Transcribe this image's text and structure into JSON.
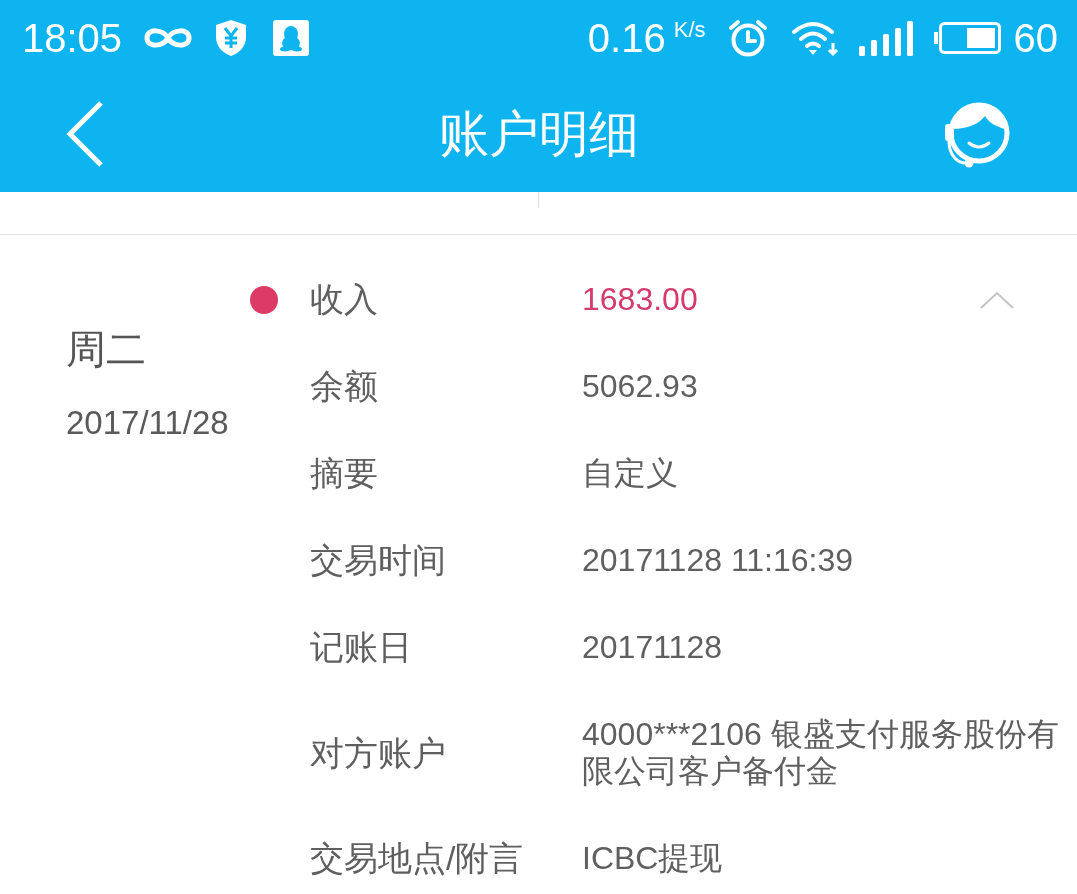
{
  "status_bar": {
    "time": "18:05",
    "net_speed": "0.16",
    "net_speed_unit": "K/s",
    "battery_percent": "60"
  },
  "header": {
    "title": "账户明细"
  },
  "transaction": {
    "weekday": "周二",
    "date": "2017/11/28",
    "expanded": true,
    "details": [
      {
        "kind": "amount",
        "label": "收入",
        "value": "1683.00"
      },
      {
        "kind": "text",
        "label": "余额",
        "value": "5062.93"
      },
      {
        "kind": "text",
        "label": "摘要",
        "value": "自定义"
      },
      {
        "kind": "text",
        "label": "交易时间",
        "value": "20171128 11:16:39"
      },
      {
        "kind": "text",
        "label": "记账日",
        "value": "20171128"
      },
      {
        "kind": "text",
        "label": "对方账户",
        "value": "4000***2106 银盛支付服务股份有限公司客户备付金"
      },
      {
        "kind": "text",
        "label": "交易地点/附言",
        "value": "ICBC提现"
      }
    ]
  }
}
